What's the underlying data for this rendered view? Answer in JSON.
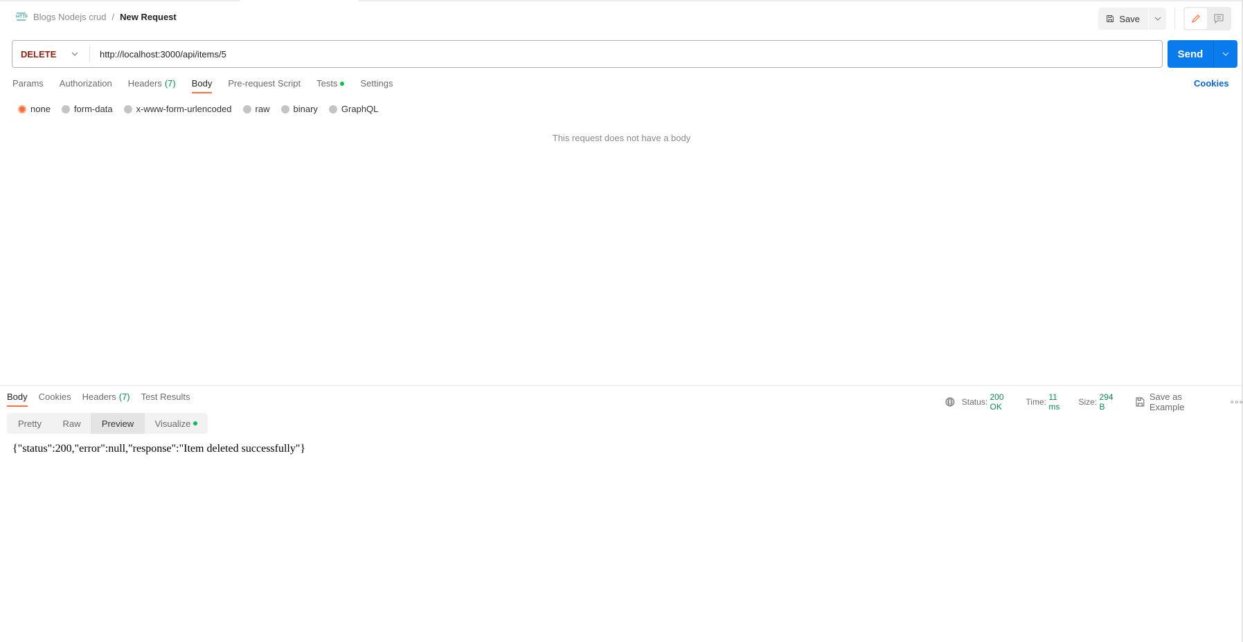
{
  "breadcrumb": {
    "icon": "http-icon",
    "collection": "Blogs Nodejs crud",
    "separator": "/",
    "request": "New Request"
  },
  "toolbar": {
    "save_label": "Save"
  },
  "request": {
    "method": "DELETE",
    "url": "http://localhost:3000/api/items/5",
    "send_label": "Send"
  },
  "request_tabs": [
    {
      "label": "Params"
    },
    {
      "label": "Authorization"
    },
    {
      "label": "Headers",
      "count": "(7)"
    },
    {
      "label": "Body",
      "active": true
    },
    {
      "label": "Pre-request Script"
    },
    {
      "label": "Tests",
      "dot": true
    },
    {
      "label": "Settings"
    }
  ],
  "cookies_label": "Cookies",
  "body_types": [
    {
      "label": "none",
      "selected": true
    },
    {
      "label": "form-data"
    },
    {
      "label": "x-www-form-urlencoded"
    },
    {
      "label": "raw"
    },
    {
      "label": "binary"
    },
    {
      "label": "GraphQL"
    }
  ],
  "empty_body_message": "This request does not have a body",
  "response": {
    "tabs": [
      {
        "label": "Body",
        "active": true
      },
      {
        "label": "Cookies"
      },
      {
        "label": "Headers",
        "count": "(7)"
      },
      {
        "label": "Test Results"
      }
    ],
    "status_label": "Status:",
    "status_value": "200 OK",
    "time_label": "Time:",
    "time_value": "11 ms",
    "size_label": "Size:",
    "size_value": "294 B",
    "save_example_label": "Save as Example",
    "views": [
      {
        "label": "Pretty"
      },
      {
        "label": "Raw"
      },
      {
        "label": "Preview",
        "active": true
      },
      {
        "label": "Visualize",
        "dot": true
      }
    ],
    "body": "{\"status\":200,\"error\":null,\"response\":\"Item deleted successfully\"}"
  },
  "colors": {
    "accent": "#ff6c37",
    "send": "#097bed",
    "method_delete": "#8e1a10",
    "success": "#0b8a4e"
  }
}
